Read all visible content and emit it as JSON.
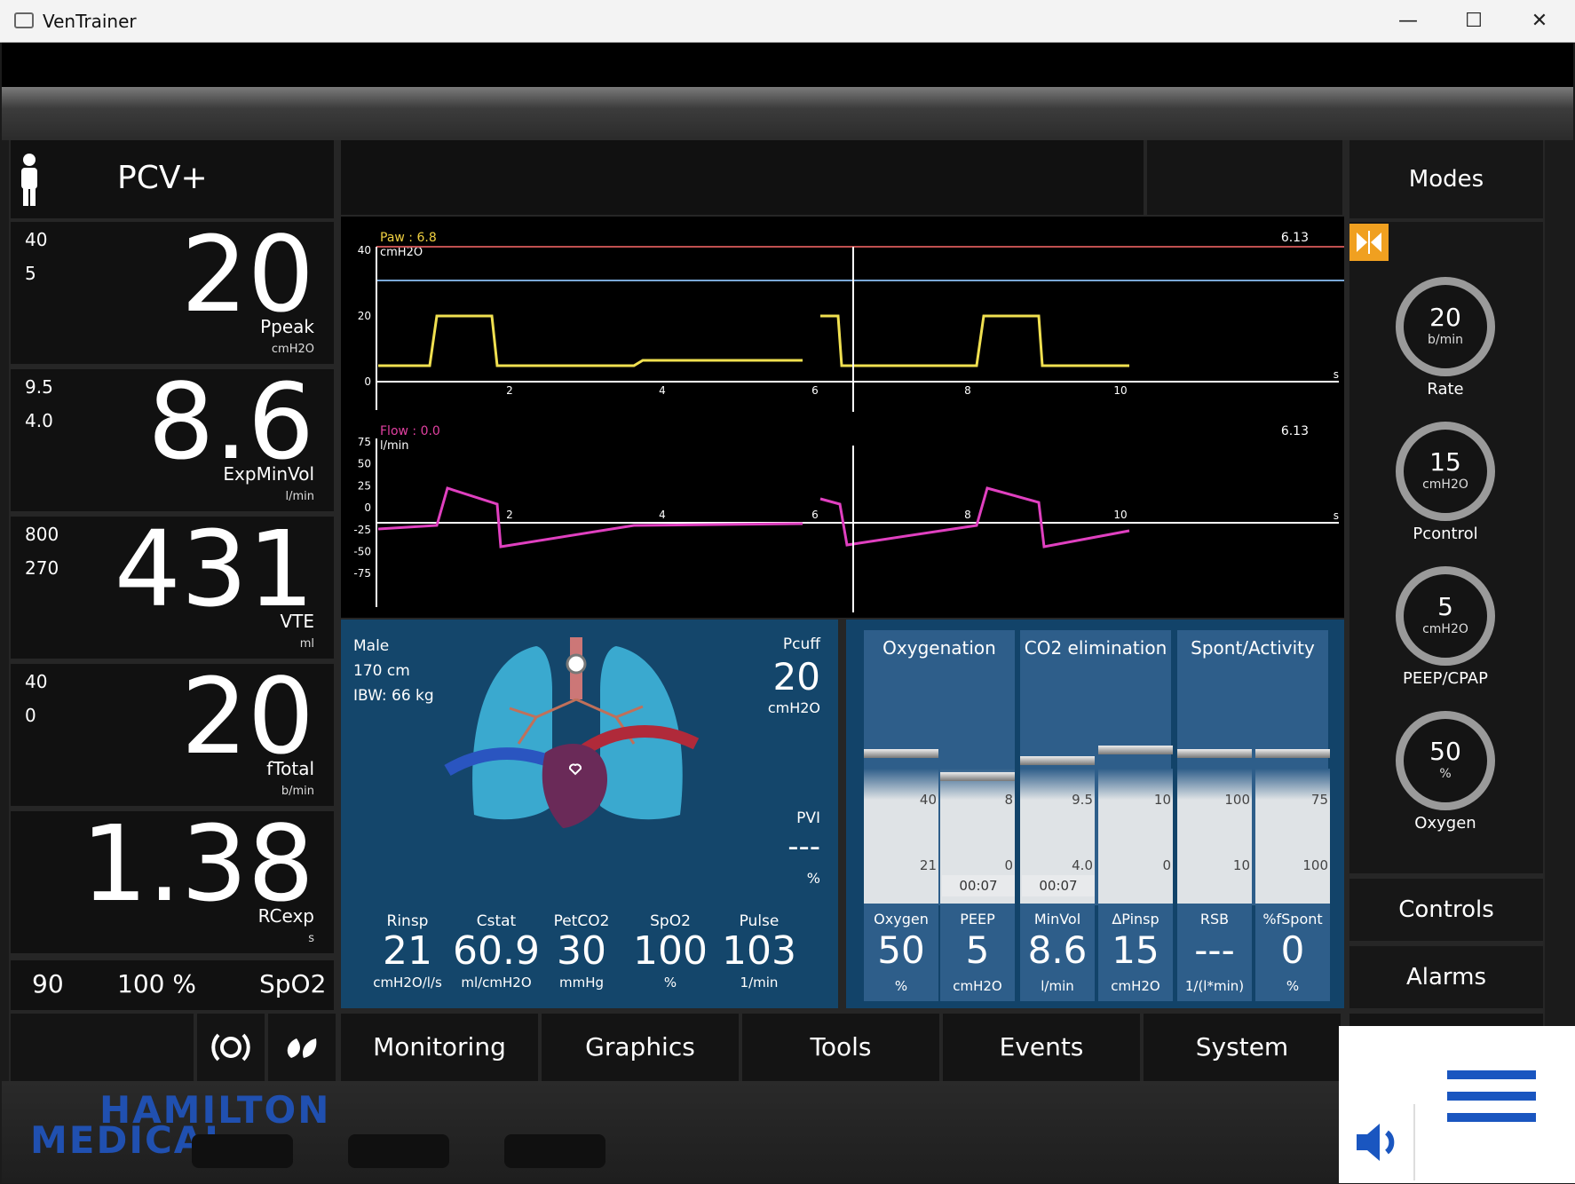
{
  "window": {
    "title": "VenTrainer",
    "minimize": "—",
    "maximize": "☐",
    "close": "✕"
  },
  "mode": {
    "name": "PCV+"
  },
  "params": [
    {
      "hi": "40",
      "lo": "5",
      "value": "20",
      "name": "Ppeak",
      "unit": "cmH2O"
    },
    {
      "hi": "9.5",
      "lo": "4.0",
      "value": "8.6",
      "name": "ExpMinVol",
      "unit": "l/min"
    },
    {
      "hi": "800",
      "lo": "270",
      "value": "431",
      "name": "VTE",
      "unit": "ml"
    },
    {
      "hi": "40",
      "lo": "0",
      "value": "20",
      "name": "fTotal",
      "unit": "b/min"
    },
    {
      "hi": "",
      "lo": "",
      "value": "1.38",
      "name": "RCexp",
      "unit": "s"
    }
  ],
  "spo2_row": {
    "a": "90",
    "b": "100 %",
    "label": "SpO2"
  },
  "graphs": {
    "paw": {
      "label": "Paw : 6.8",
      "unit": "cmH2O",
      "cursor": "6.13",
      "yticks": [
        "40",
        "20",
        "0"
      ],
      "xticks": [
        "2",
        "4",
        "6",
        "8",
        "10"
      ],
      "xunit": "s"
    },
    "flow": {
      "label": "Flow : 0.0",
      "unit": "l/min",
      "cursor": "6.13",
      "yticks": [
        "75",
        "50",
        "25",
        "0",
        "-25",
        "-50",
        "-75"
      ],
      "xticks": [
        "2",
        "4",
        "6",
        "8",
        "10"
      ],
      "xunit": "s"
    },
    "colors": {
      "paw": "#f0e050",
      "flow": "#e040c0",
      "alarm_hi": "#c05050",
      "alarm_lo": "#7aa8d8"
    }
  },
  "patient": {
    "sex": "Male",
    "height": "170  cm",
    "ibw": "IBW:  66  kg",
    "pcuff": {
      "label": "Pcuff",
      "value": "20",
      "unit": "cmH2O"
    },
    "pvi": {
      "label": "PVI",
      "value": "---",
      "unit": "%"
    },
    "readings": [
      {
        "label": "Rinsp",
        "value": "21",
        "unit": "cmH2O/l/s"
      },
      {
        "label": "Cstat",
        "value": "60.9",
        "unit": "ml/cmH2O"
      },
      {
        "label": "PetCO2",
        "value": "30",
        "unit": "mmHg"
      },
      {
        "label": "SpO2",
        "value": "100",
        "unit": "%"
      },
      {
        "label": "Pulse",
        "value": "103",
        "unit": "1/min"
      }
    ]
  },
  "vent": {
    "groups": [
      "Oxygenation",
      "CO2 elimination",
      "Spont/Activity"
    ],
    "scales": [
      {
        "top": "40",
        "bottom": "21"
      },
      {
        "top": "8",
        "bottom": "0",
        "timer": "00:07"
      },
      {
        "top": "9.5",
        "bottom": "4.0",
        "timer": "00:07"
      },
      {
        "top": "10",
        "bottom": "0"
      },
      {
        "top": "100",
        "bottom": "10"
      },
      {
        "top": "75",
        "bottom": "100"
      }
    ],
    "readings": [
      {
        "label": "Oxygen",
        "value": "50",
        "unit": "%"
      },
      {
        "label": "PEEP",
        "value": "5",
        "unit": "cmH2O"
      },
      {
        "label": "MinVol",
        "value": "8.6",
        "unit": "l/min"
      },
      {
        "label": "ΔPinsp",
        "value": "15",
        "unit": "cmH2O"
      },
      {
        "label": "RSB",
        "value": "---",
        "unit": "1/(l*min)"
      },
      {
        "label": "%fSpont",
        "value": "0",
        "unit": "%"
      }
    ]
  },
  "right": {
    "modes": "Modes",
    "controls_btn": "Controls",
    "alarms_btn": "Alarms",
    "knobs": [
      {
        "value": "20",
        "unit": "b/min",
        "label": "Rate"
      },
      {
        "value": "15",
        "unit": "cmH2O",
        "label": "Pcontrol"
      },
      {
        "value": "5",
        "unit": "cmH2O",
        "label": "PEEP/CPAP"
      },
      {
        "value": "50",
        "unit": "%",
        "label": "Oxygen"
      }
    ]
  },
  "tabs": [
    "Monitoring",
    "Graphics",
    "Tools",
    "Events",
    "System"
  ],
  "brand": {
    "line1": "HAMILTON",
    "line2": "MEDICAL"
  }
}
